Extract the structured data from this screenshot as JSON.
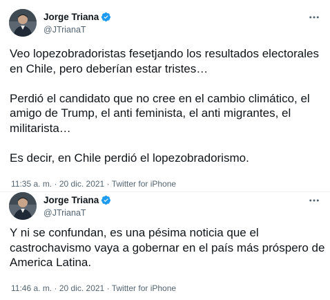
{
  "tweets": [
    {
      "author": {
        "name": "Jorge Triana",
        "handle": "@JTrianaT",
        "verified": true
      },
      "paragraphs": [
        "Veo lopezobradoristas fesetjando los resultados electorales en Chile, pero deberían estar tristes…",
        "Perdió el candidato que no cree en el cambio climático, el amigo de Trump, el anti feminista, el anti migrantes, el militarista…",
        "Es decir, en Chile perdió el lopezobradorismo."
      ],
      "time": "11:35 a. m.",
      "date": "20 dic. 2021",
      "source": "Twitter for iPhone"
    },
    {
      "author": {
        "name": "Jorge Triana",
        "handle": "@JTrianaT",
        "verified": true
      },
      "paragraphs": [
        "Y ni se confundan, es una pésima noticia que el castrochavismo vaya a gobernar en el país más próspero de America Latina."
      ],
      "time": "11:46 a. m.",
      "date": "20 dic. 2021",
      "source": "Twitter for iPhone"
    }
  ],
  "separator": "·",
  "colors": {
    "verified": "#1d9bf0",
    "secondary_text": "#536471",
    "primary_text": "#0f1419"
  },
  "icons": {
    "verified": "verified-badge-icon",
    "more": "more-options-icon"
  }
}
